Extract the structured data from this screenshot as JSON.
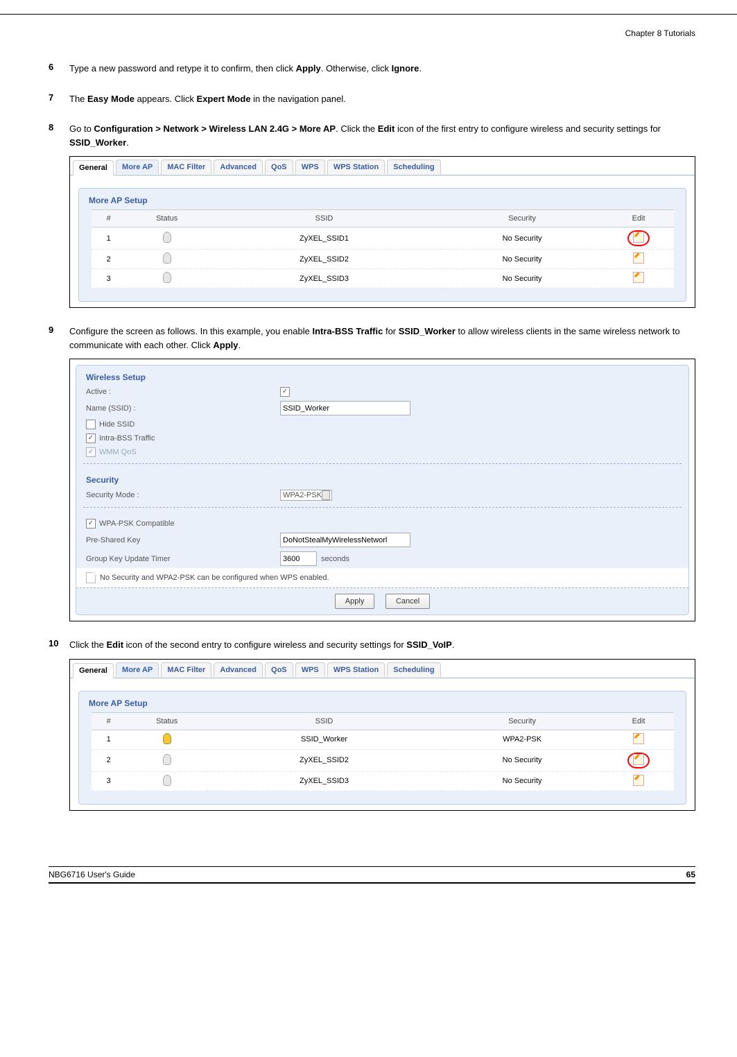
{
  "header": {
    "chapter": "Chapter 8 Tutorials"
  },
  "footer": {
    "guide": "NBG6716 User's Guide",
    "page": "65"
  },
  "steps": {
    "s6": {
      "num": "6",
      "text_a": "Type a new password and retype it to confirm, then click ",
      "b1": "Apply",
      "text_b": ". Otherwise, click ",
      "b2": "Ignore",
      "text_c": "."
    },
    "s7": {
      "num": "7",
      "text_a": "The ",
      "b1": "Easy Mode",
      "text_b": " appears. Click ",
      "b2": "Expert Mode",
      "text_c": " in the navigation panel."
    },
    "s8": {
      "num": "8",
      "text_a": "Go to ",
      "b1": "Configuration > Network > Wireless LAN 2.4G > More AP",
      "text_b": ". Click the ",
      "b2": "Edit",
      "text_c": " icon of the first entry to configure wireless and security settings for ",
      "b3": "SSID_Worker",
      "text_d": "."
    },
    "s9": {
      "num": "9",
      "text_a": "Configure the screen as follows. In this example, you enable ",
      "b1": "Intra-BSS Traffic",
      "text_b": " for ",
      "b2": "SSID_Worker",
      "text_c": " to allow wireless clients in the same wireless network to communicate with each other. Click ",
      "b3": "Apply",
      "text_d": "."
    },
    "s10": {
      "num": "10",
      "text_a": "Click the ",
      "b1": "Edit",
      "text_b": " icon of the second entry to configure wireless and security settings for ",
      "b2": "SSID_VoIP",
      "text_c": "."
    }
  },
  "tabs": [
    "General",
    "More AP",
    "MAC Filter",
    "Advanced",
    "QoS",
    "WPS",
    "WPS Station",
    "Scheduling"
  ],
  "more_ap": {
    "title": "More AP Setup",
    "cols": [
      "#",
      "Status",
      "SSID",
      "Security",
      "Edit"
    ],
    "rows1": [
      {
        "n": "1",
        "status": "off",
        "ssid": "ZyXEL_SSID1",
        "sec": "No Security",
        "hi": true
      },
      {
        "n": "2",
        "status": "off",
        "ssid": "ZyXEL_SSID2",
        "sec": "No Security",
        "hi": false
      },
      {
        "n": "3",
        "status": "off",
        "ssid": "ZyXEL_SSID3",
        "sec": "No Security",
        "hi": false
      }
    ],
    "rows2": [
      {
        "n": "1",
        "status": "on",
        "ssid": "SSID_Worker",
        "sec": "WPA2-PSK",
        "hi": false
      },
      {
        "n": "2",
        "status": "off",
        "ssid": "ZyXEL_SSID2",
        "sec": "No Security",
        "hi": true
      },
      {
        "n": "3",
        "status": "off",
        "ssid": "ZyXEL_SSID3",
        "sec": "No Security",
        "hi": false
      }
    ]
  },
  "wireless": {
    "section1": "Wireless Setup",
    "active_label": "Active :",
    "name_label": "Name (SSID) :",
    "name_value": "SSID_Worker",
    "hide_label": "Hide SSID",
    "intra_label": "Intra-BSS Traffic",
    "wmm_label": "WMM QoS",
    "section2": "Security",
    "secmode_label": "Security Mode :",
    "secmode_value": "WPA2-PSK",
    "wpa_label": "WPA-PSK Compatible",
    "psk_label": "Pre-Shared Key",
    "psk_value": "DoNotStealMyWirelessNetworl",
    "gk_label": "Group Key Update Timer",
    "gk_value": "3600",
    "gk_unit": "seconds",
    "note": "No Security and WPA2-PSK can be configured when WPS enabled.",
    "apply": "Apply",
    "cancel": "Cancel"
  }
}
